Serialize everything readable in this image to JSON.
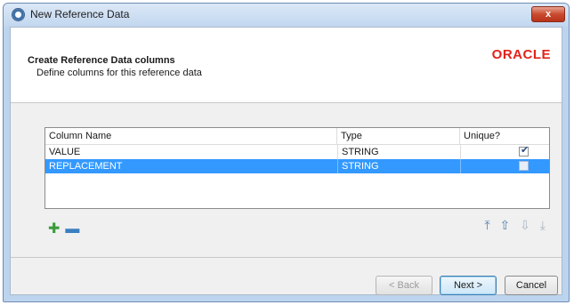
{
  "window": {
    "title": "New Reference Data",
    "close_label": "x"
  },
  "header": {
    "title": "Create Reference Data columns",
    "subtitle": "Define columns for this reference data",
    "logo_text": "ORACLE"
  },
  "table": {
    "columns": [
      "Column Name",
      "Type",
      "Unique?"
    ],
    "rows": [
      {
        "name": "VALUE",
        "type": "STRING",
        "unique": true
      },
      {
        "name": "REPLACEMENT",
        "type": "STRING",
        "unique": false,
        "selected": true
      }
    ]
  },
  "toolbar": {
    "add_icon": "plus-icon",
    "remove_icon": "minus-icon",
    "move_top_icon": "move-top-icon",
    "move_up_icon": "move-up-icon",
    "move_down_icon": "move-down-icon",
    "move_bottom_icon": "move-bottom-icon"
  },
  "buttons": {
    "back": "< Back",
    "next": "Next >",
    "cancel": "Cancel"
  },
  "colors": {
    "selection": "#3399ff",
    "oracle_red": "#e2231a"
  }
}
